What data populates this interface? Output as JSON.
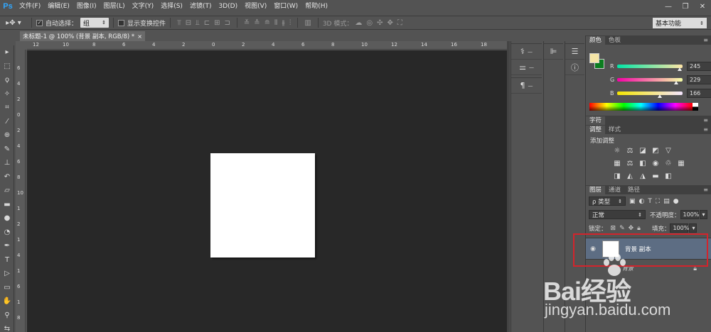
{
  "app": {
    "logo": "Ps"
  },
  "menu": [
    "文件(F)",
    "编辑(E)",
    "图像(I)",
    "图层(L)",
    "文字(Y)",
    "选择(S)",
    "滤镜(T)",
    "3D(D)",
    "视图(V)",
    "窗口(W)",
    "帮助(H)"
  ],
  "window_controls": {
    "minimize": "—",
    "restore": "❐",
    "close": "✕"
  },
  "options": {
    "auto_select_label": "自动选择：",
    "auto_select_checked": true,
    "auto_select_value": "组",
    "show_transform_label": "显示变换控件",
    "mode_3d_label": "3D 模式：",
    "workspace": "基本功能"
  },
  "document": {
    "tab_title": "未标题-1 @ 100% (背景 副本, RGB/8) *",
    "close": "×",
    "canvas_color": "#ffffff"
  },
  "rulers": {
    "top": [
      "12",
      "10",
      "8",
      "6",
      "4",
      "2",
      "0",
      "2",
      "4",
      "6",
      "8",
      "10",
      "12",
      "14",
      "16",
      "18"
    ],
    "left": [
      "6",
      "4",
      "2",
      "0",
      "2",
      "4",
      "6",
      "8",
      "10",
      "1",
      "2",
      "1",
      "4",
      "1",
      "6",
      "1",
      "8"
    ]
  },
  "panels": {
    "color": {
      "tabs": [
        "颜色",
        "色板"
      ],
      "foreground": "#f5e5a6",
      "background": "#0b7d1f",
      "r_label": "R",
      "g_label": "G",
      "b_label": "B",
      "r": "245",
      "g": "229",
      "b": "166",
      "r_frac": 0.96,
      "g_frac": 0.9,
      "b_frac": 0.65
    },
    "character": {
      "tabs": [
        "字符"
      ]
    },
    "adjustments": {
      "tabs": [
        "调整",
        "样式"
      ],
      "title": "添加调整"
    },
    "layers": {
      "tabs": [
        "图层",
        "通道",
        "路径"
      ],
      "filter_label": "ρ 类型",
      "blend_mode": "正常",
      "opacity_label": "不透明度：",
      "opacity": "100%",
      "lock_label": "锁定：",
      "fill_label": "填充：",
      "fill": "100%",
      "items": [
        {
          "name": "背景 副本",
          "selected": true
        },
        {
          "name": "背景",
          "locked": true
        }
      ]
    }
  },
  "watermark": {
    "logo": "Bai经验",
    "url": "jingyan.baidu.com"
  }
}
